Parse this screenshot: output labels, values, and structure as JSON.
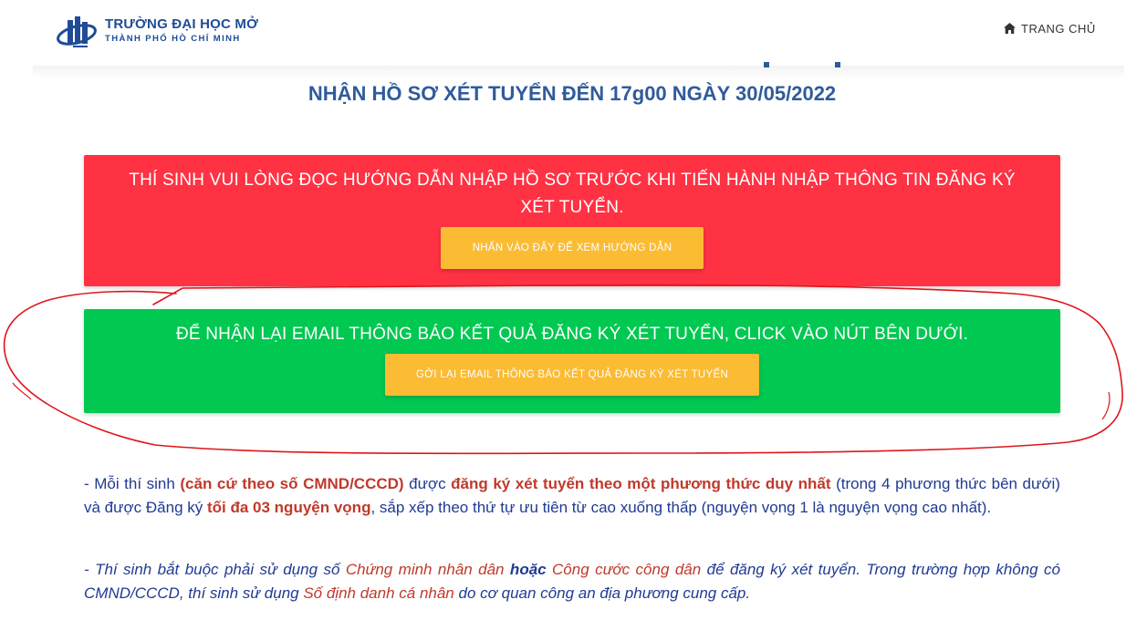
{
  "header": {
    "logo_name": "TRƯỜNG ĐẠI HỌC MỞ",
    "logo_city": "THÀNH PHỐ HỒ CHÍ MINH",
    "nav_home_label": "TRANG CHỦ",
    "nav_home_icon": "home-icon"
  },
  "main": {
    "deadline_title": "NHẬN HỒ SƠ XÉT TUYỂN ĐẾN 17g00 NGÀY 30/05/2022",
    "guide_box": {
      "message": "THÍ SINH VUI LÒNG ĐỌC HƯỚNG DẪN NHẬP HỒ SƠ TRƯỚC KHI TIẾN HÀNH NHẬP THÔNG TIN ĐĂNG KÝ XÉT TUYỂN.",
      "button_label": "NHẤN VÀO ĐÂY ĐỂ XEM HƯỚNG DẪN",
      "color": "#fe3243"
    },
    "resend_box": {
      "message": "ĐỂ NHẬN LẠI EMAIL THÔNG BÁO KẾT QUẢ ĐĂNG KÝ XÉT TUYỂN, CLICK VÀO NÚT BÊN DƯỚI.",
      "button_label": "GỞI LẠI EMAIL THÔNG BÁO KẾT QUẢ ĐĂNG KÝ XÉT TUYỂN",
      "color": "#00c851"
    },
    "note1": {
      "t1": "- Mỗi thí sinh ",
      "b1": "(căn cứ theo số CMND/CCCD)",
      "t2": " được ",
      "b2": "đăng ký xét tuyển theo một phương thức duy nhất",
      "t3": " (trong 4 phương thức bên dưới) và được Đăng ký ",
      "b3": "tối đa 03 nguyện vọng",
      "t4": ", sắp xếp theo thứ tự ưu tiên từ cao xuống thấp (nguyện vọng 1 là nguyện vọng cao nhất)."
    },
    "note2": {
      "t1": "- Thí sinh bắt buộc phải sử dụng số ",
      "r1": "Chứng minh nhân dân",
      "b1": " hoặc ",
      "r2": "Công cước công dân",
      "t2": " để đăng ký xét tuyển. Trong trường hợp không có CMND/CCCD, thí sinh sử dụng ",
      "r3": "Số định danh cá nhân",
      "t3": " do cơ quan công an địa phương cung cấp."
    }
  },
  "colors": {
    "accent_blue": "#2f5b9c",
    "button_yellow": "#fbbb33",
    "annotation_red": "#e0151b"
  }
}
